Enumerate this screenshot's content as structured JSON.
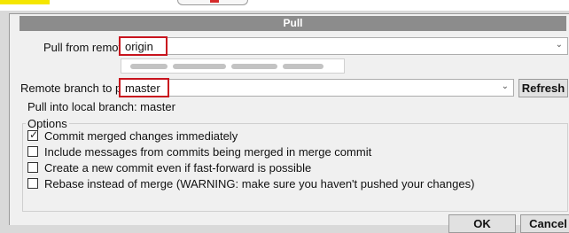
{
  "dialog": {
    "title": "Pull",
    "pull_from_remote_label": "Pull from remote:",
    "remote_value": "origin",
    "remote_branch_label": "Remote branch to pull:",
    "branch_value": "master",
    "refresh_label": "Refresh",
    "local_branch_text": "Pull into local branch: master",
    "options_legend": "Options",
    "options": [
      {
        "label": "Commit merged changes immediately",
        "checked": true
      },
      {
        "label": "Include messages from commits being merged in merge commit",
        "checked": false
      },
      {
        "label": "Create a new commit even if fast-forward is possible",
        "checked": false
      },
      {
        "label": "Rebase instead of merge (WARNING: make sure you haven't pushed your changes)",
        "checked": false
      }
    ],
    "ok_label": "OK",
    "cancel_label": "Cancel",
    "check_glyph": "✓",
    "chevron_glyph": "⌄"
  },
  "colors": {
    "highlight": "#c8141e",
    "title_bar": "#8c8c8c",
    "top_strip_accent": "#f5e600"
  }
}
